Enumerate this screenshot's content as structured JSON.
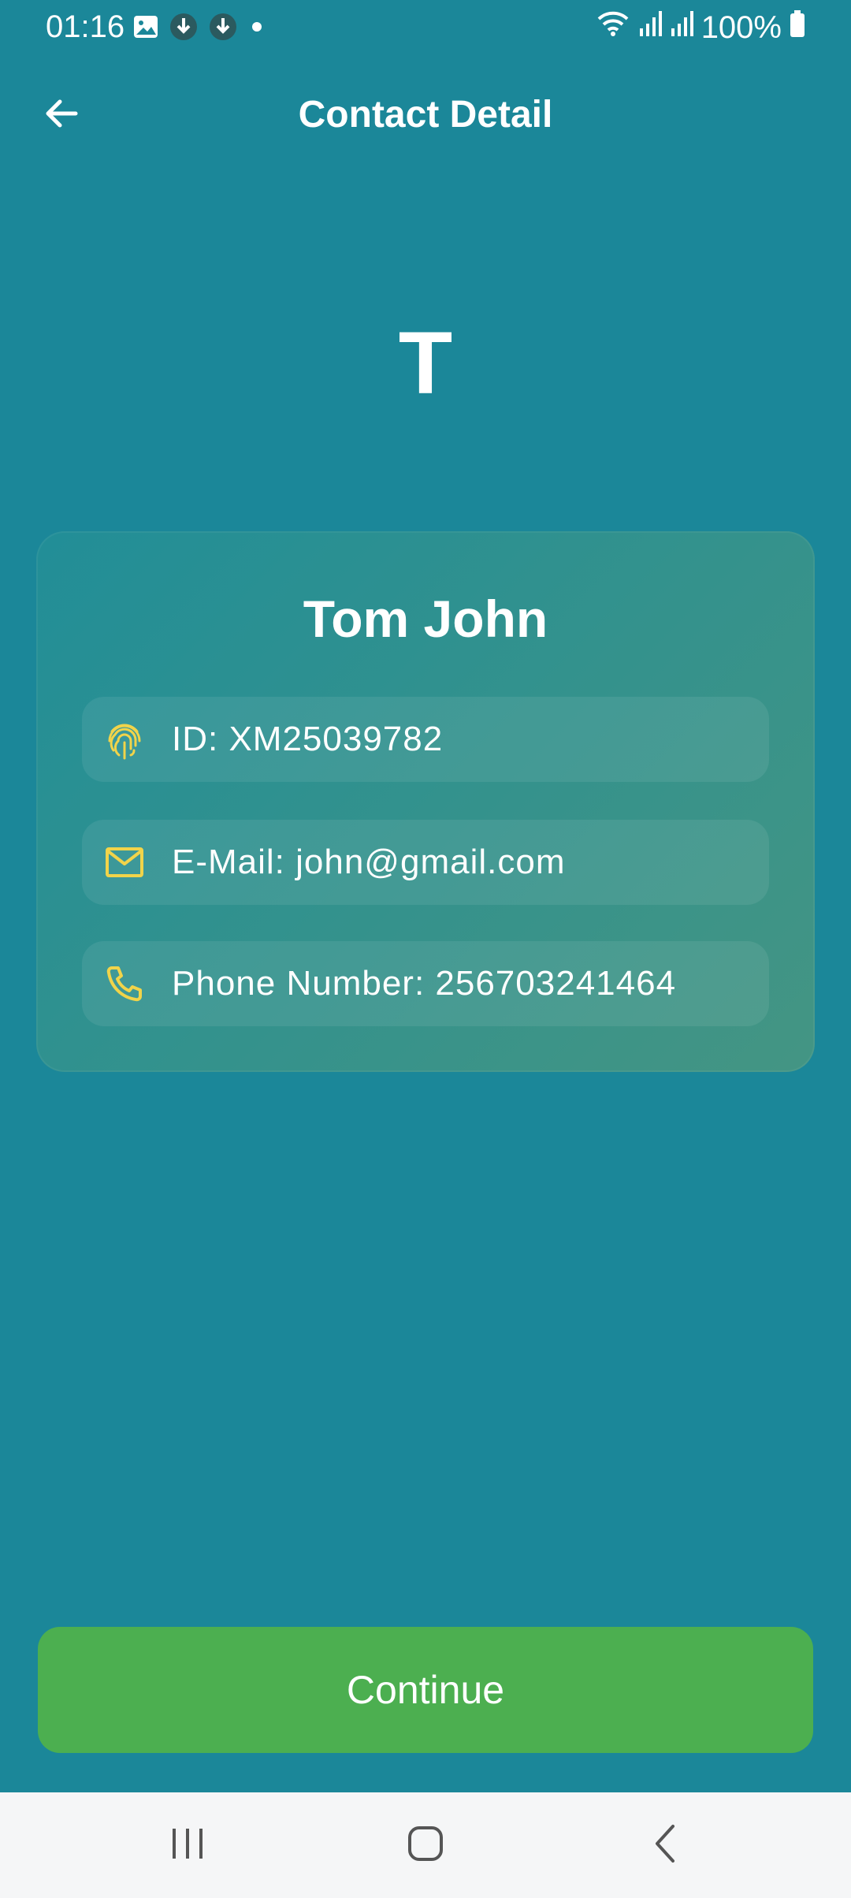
{
  "status_bar": {
    "time": "01:16",
    "battery": "100%",
    "icons": [
      "image-icon",
      "download-icon",
      "download-icon",
      "dot-icon",
      "wifi-icon",
      "signal-icon",
      "signal-icon",
      "battery-icon"
    ]
  },
  "header": {
    "title": "Contact Detail",
    "back_icon": "arrow-left-icon"
  },
  "avatar": {
    "initial": "T"
  },
  "contact": {
    "name": "Tom John",
    "rows": [
      {
        "icon": "fingerprint-icon",
        "text": "ID: XM25039782"
      },
      {
        "icon": "mail-icon",
        "text": "E-Mail: john@gmail.com"
      },
      {
        "icon": "phone-icon",
        "text": "Phone Number: 256703241464"
      }
    ]
  },
  "actions": {
    "continue_label": "Continue"
  },
  "nav": {
    "buttons": [
      "recents-icon",
      "home-icon",
      "back-icon"
    ]
  },
  "colors": {
    "background": "#1b8799",
    "accent_icon": "#f1d44a",
    "button": "#4caf50",
    "navbar": "#f5f6f7"
  }
}
